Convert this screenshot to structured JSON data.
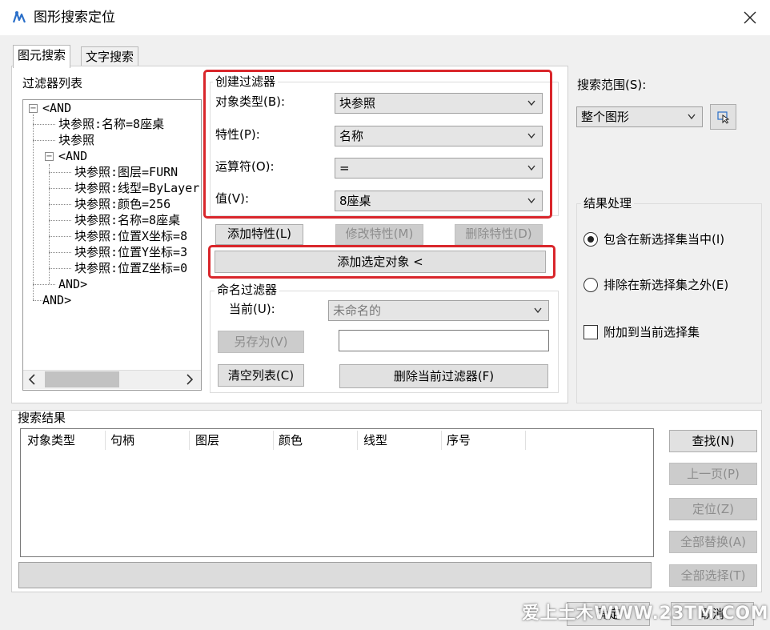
{
  "window": {
    "title": "图形搜索定位",
    "icon": "app-icon",
    "close_icon": "close-icon"
  },
  "tabs": [
    {
      "label": "图元搜索",
      "active": true
    },
    {
      "label": "文字搜索",
      "active": false
    }
  ],
  "filter_list": {
    "label": "过滤器列表",
    "tree": [
      "<AND",
      "块参照:名称=8座桌",
      "块参照",
      "<AND",
      "块参照:图层=FURN",
      "块参照:线型=ByLayer",
      "块参照:颜色=256",
      "块参照:名称=8座桌",
      "块参照:位置X坐标=8",
      "块参照:位置Y坐标=3",
      "块参照:位置Z坐标=0",
      "AND>",
      "AND>"
    ]
  },
  "create_filter": {
    "title": "创建过滤器",
    "object_type_label": "对象类型(B):",
    "object_type_value": "块参照",
    "property_label": "特性(P):",
    "property_value": "名称",
    "operator_label": "运算符(O):",
    "operator_value": "=",
    "value_label": "值(V):",
    "value_value": "8座桌",
    "add_property": "添加特性(L)",
    "modify_property": "修改特性(M)",
    "delete_property": "删除特性(D)",
    "add_selected_object": "添加选定对象 <"
  },
  "named_filter": {
    "title": "命名过滤器",
    "current_label": "当前(U):",
    "current_value": "未命名的",
    "save_as": "另存为(V)",
    "save_as_input": "",
    "clear_list": "清空列表(C)",
    "delete_current": "删除当前过滤器(F)"
  },
  "search_scope": {
    "label": "搜索范围(S):",
    "value": "整个图形",
    "pick_icon": "select-objects-icon"
  },
  "result_processing": {
    "title": "结果处理",
    "options": [
      {
        "label": "包含在新选择集当中(I)",
        "checked": true
      },
      {
        "label": "排除在新选择集之外(E)",
        "checked": false
      }
    ],
    "append_label": "附加到当前选择集",
    "append_checked": false
  },
  "search_results": {
    "title": "搜索结果",
    "columns": [
      "对象类型",
      "句柄",
      "图层",
      "颜色",
      "线型",
      "序号"
    ],
    "status": ""
  },
  "actions": {
    "find": "查找(N)",
    "prev_page": "上一页(P)",
    "locate": "定位(Z)",
    "replace_all": "全部替换(A)",
    "select_all": "全部选择(T)",
    "ok": "确定",
    "cancel": "取消"
  },
  "watermark": "爱上土木WWW.23TM.COM",
  "colors": {
    "highlight_red": "#d9262b",
    "window_bg": "#f0f0f0",
    "disabled_text": "#8d8d8d"
  }
}
